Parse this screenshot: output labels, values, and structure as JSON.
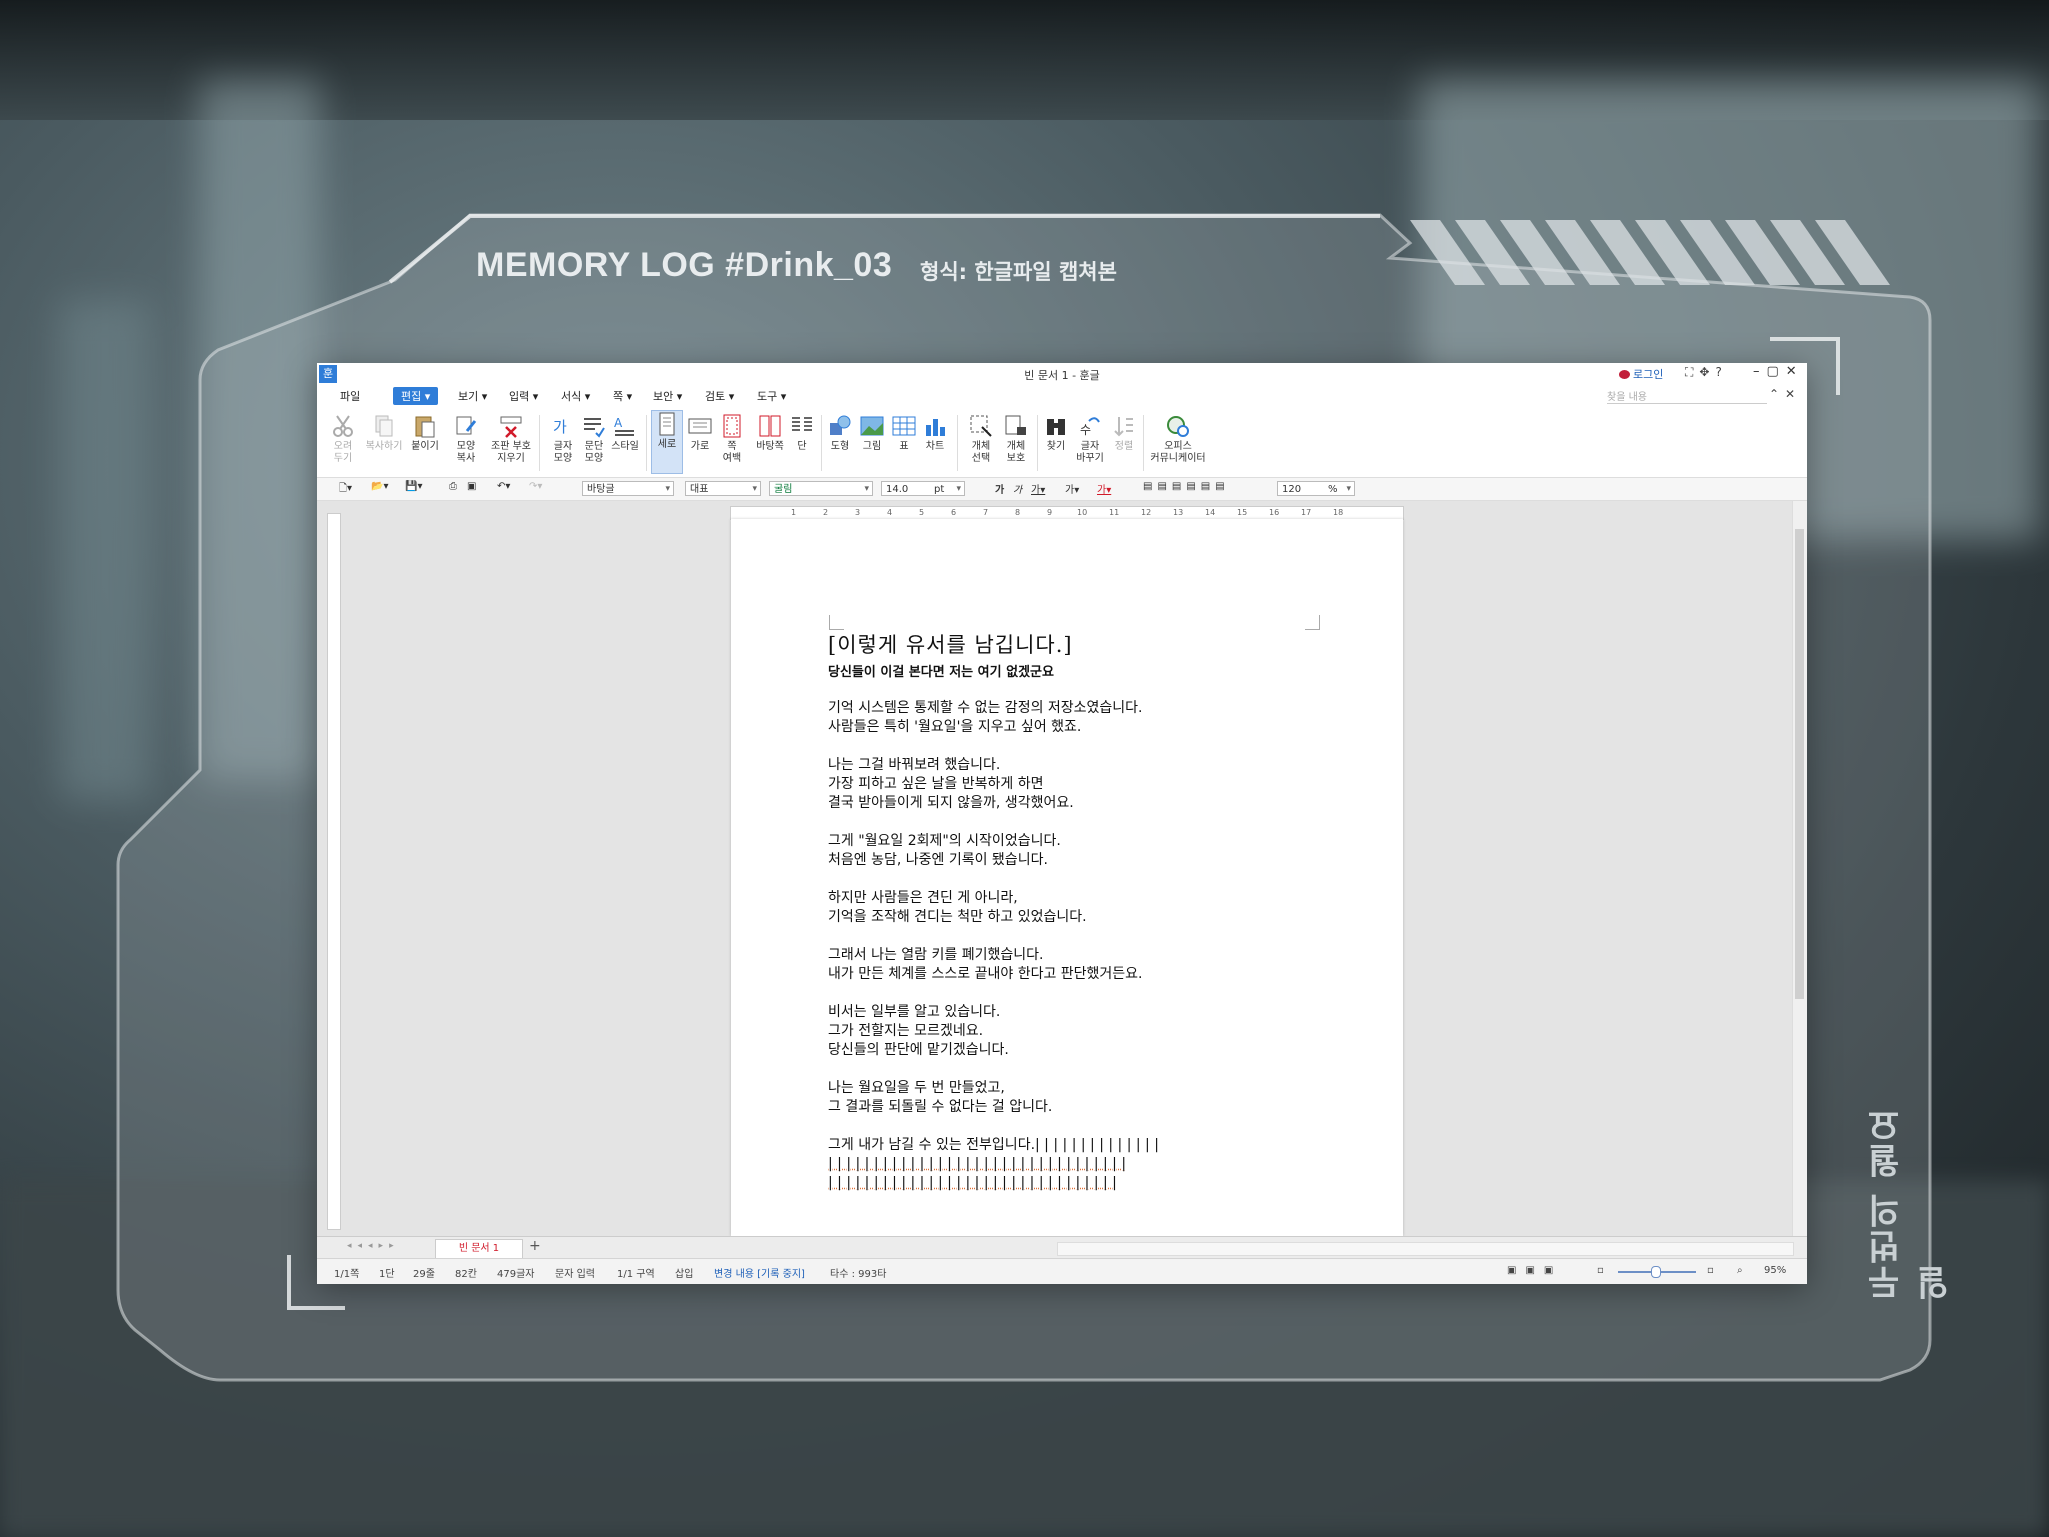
{
  "hud": {
    "title": "MEMORY LOG  #Drink_03",
    "format": "형식: 한글파일 캡쳐본",
    "side_brand": "두번의 월요일"
  },
  "window": {
    "title": "빈 문서 1 - 훈글",
    "login": "로그인",
    "search_placeholder": "찾을 내용"
  },
  "menu": [
    "파일",
    "편집",
    "보기",
    "입력",
    "서식",
    "쪽",
    "보안",
    "검토",
    "도구"
  ],
  "ribbon": [
    {
      "label": "오려\n두기",
      "icon": "scissors-icon",
      "disabled": true
    },
    {
      "label": "복사하기",
      "icon": "copy-icon",
      "disabled": true
    },
    {
      "label": "붙이기",
      "icon": "paste-icon"
    },
    {
      "label": "모양\n복사",
      "icon": "format-painter-icon"
    },
    {
      "label": "조판 부호\n지우기",
      "icon": "clear-codes-icon"
    },
    {
      "label": "글자\n모양",
      "icon": "char-shape-icon"
    },
    {
      "label": "문단\n모양",
      "icon": "para-shape-icon"
    },
    {
      "label": "스타일",
      "icon": "style-icon"
    },
    {
      "label": "세로",
      "icon": "portrait-icon",
      "selected": true
    },
    {
      "label": "가로",
      "icon": "landscape-icon"
    },
    {
      "label": "쪽\n여백",
      "icon": "margin-icon"
    },
    {
      "label": "바탕쪽",
      "icon": "master-page-icon"
    },
    {
      "label": "단",
      "icon": "columns-icon"
    },
    {
      "label": "도형",
      "icon": "shape-icon"
    },
    {
      "label": "그림",
      "icon": "picture-icon"
    },
    {
      "label": "표",
      "icon": "table-icon"
    },
    {
      "label": "차트",
      "icon": "chart-icon"
    },
    {
      "label": "개체\n선택",
      "icon": "select-object-icon"
    },
    {
      "label": "개체\n보호",
      "icon": "protect-object-icon"
    },
    {
      "label": "찾기",
      "icon": "binoculars-icon"
    },
    {
      "label": "글자\n바꾸기",
      "icon": "replace-char-icon"
    },
    {
      "label": "정렬",
      "icon": "sort-icon",
      "disabled": true
    },
    {
      "label": "오피스\n커뮤니케이터",
      "icon": "communicator-icon"
    }
  ],
  "toolbar": {
    "style": "바탕글",
    "lang": "대표",
    "font": "굴림",
    "size": "14.0",
    "unit": "pt",
    "zoom": "120",
    "zoom_unit": "%"
  },
  "document": {
    "title": "[이렇게 유서를 남깁니다.]",
    "subtitle": "당신들이 이걸 본다면 저는 여기 없겠군요",
    "paragraphs": [
      [
        "기억 시스템은 통제할 수 없는 감정의 저장소였습니다.",
        "사람들은 특히 '월요일'을 지우고 싶어 했죠."
      ],
      [
        "나는 그걸 바꿔보려 했습니다.",
        "가장 피하고 싶은 날을 반복하게 하면",
        "결국 받아들이게 되지 않을까, 생각했어요."
      ],
      [
        "그게 \"월요일 2회제\"의 시작이었습니다.",
        "처음엔 농담, 나중엔 기록이 됐습니다."
      ],
      [
        "하지만 사람들은 견딘 게 아니라,",
        "기억을 조작해 견디는 척만 하고 있었습니다."
      ],
      [
        "그래서 나는 열람 키를 폐기했습니다.",
        "내가 만든 체계를 스스로 끝내야 한다고 판단했거든요."
      ],
      [
        "비서는 일부를 알고 있습니다.",
        "그가 전할지는 모르겠네요.",
        "당신들의 판단에 맡기겠습니다."
      ],
      [
        "나는 월요일을 두 번 만들었고,",
        "그 결과를 되돌릴 수 없다는 걸 압니다."
      ],
      [
        "그게 내가 남길 수 있는 전부입니다.| | | | | | | | | | | | | |",
        "| | | | | | | | | | | | | | | | | | | | | | | | | | | | | | | | |",
        "| | | | | | | | | | | | | | | | | | | | | | | | | | | | | | | |"
      ]
    ]
  },
  "tab": {
    "name": "빈 문서 1"
  },
  "status": {
    "page": "1/1쪽",
    "column": "1단",
    "line": "29줄",
    "col": "82칸",
    "chars": "479글자",
    "input_mode": "문자 입력",
    "section": "1/1 구역",
    "insert": "삽입",
    "track_changes": "변경 내용 [기록 중지]",
    "typing": "타수 : 993타",
    "zoom": "95%"
  },
  "colors": {
    "accent": "#2f7dd8",
    "tab_text": "#d11a2a",
    "squiggle": "#e0723a"
  }
}
